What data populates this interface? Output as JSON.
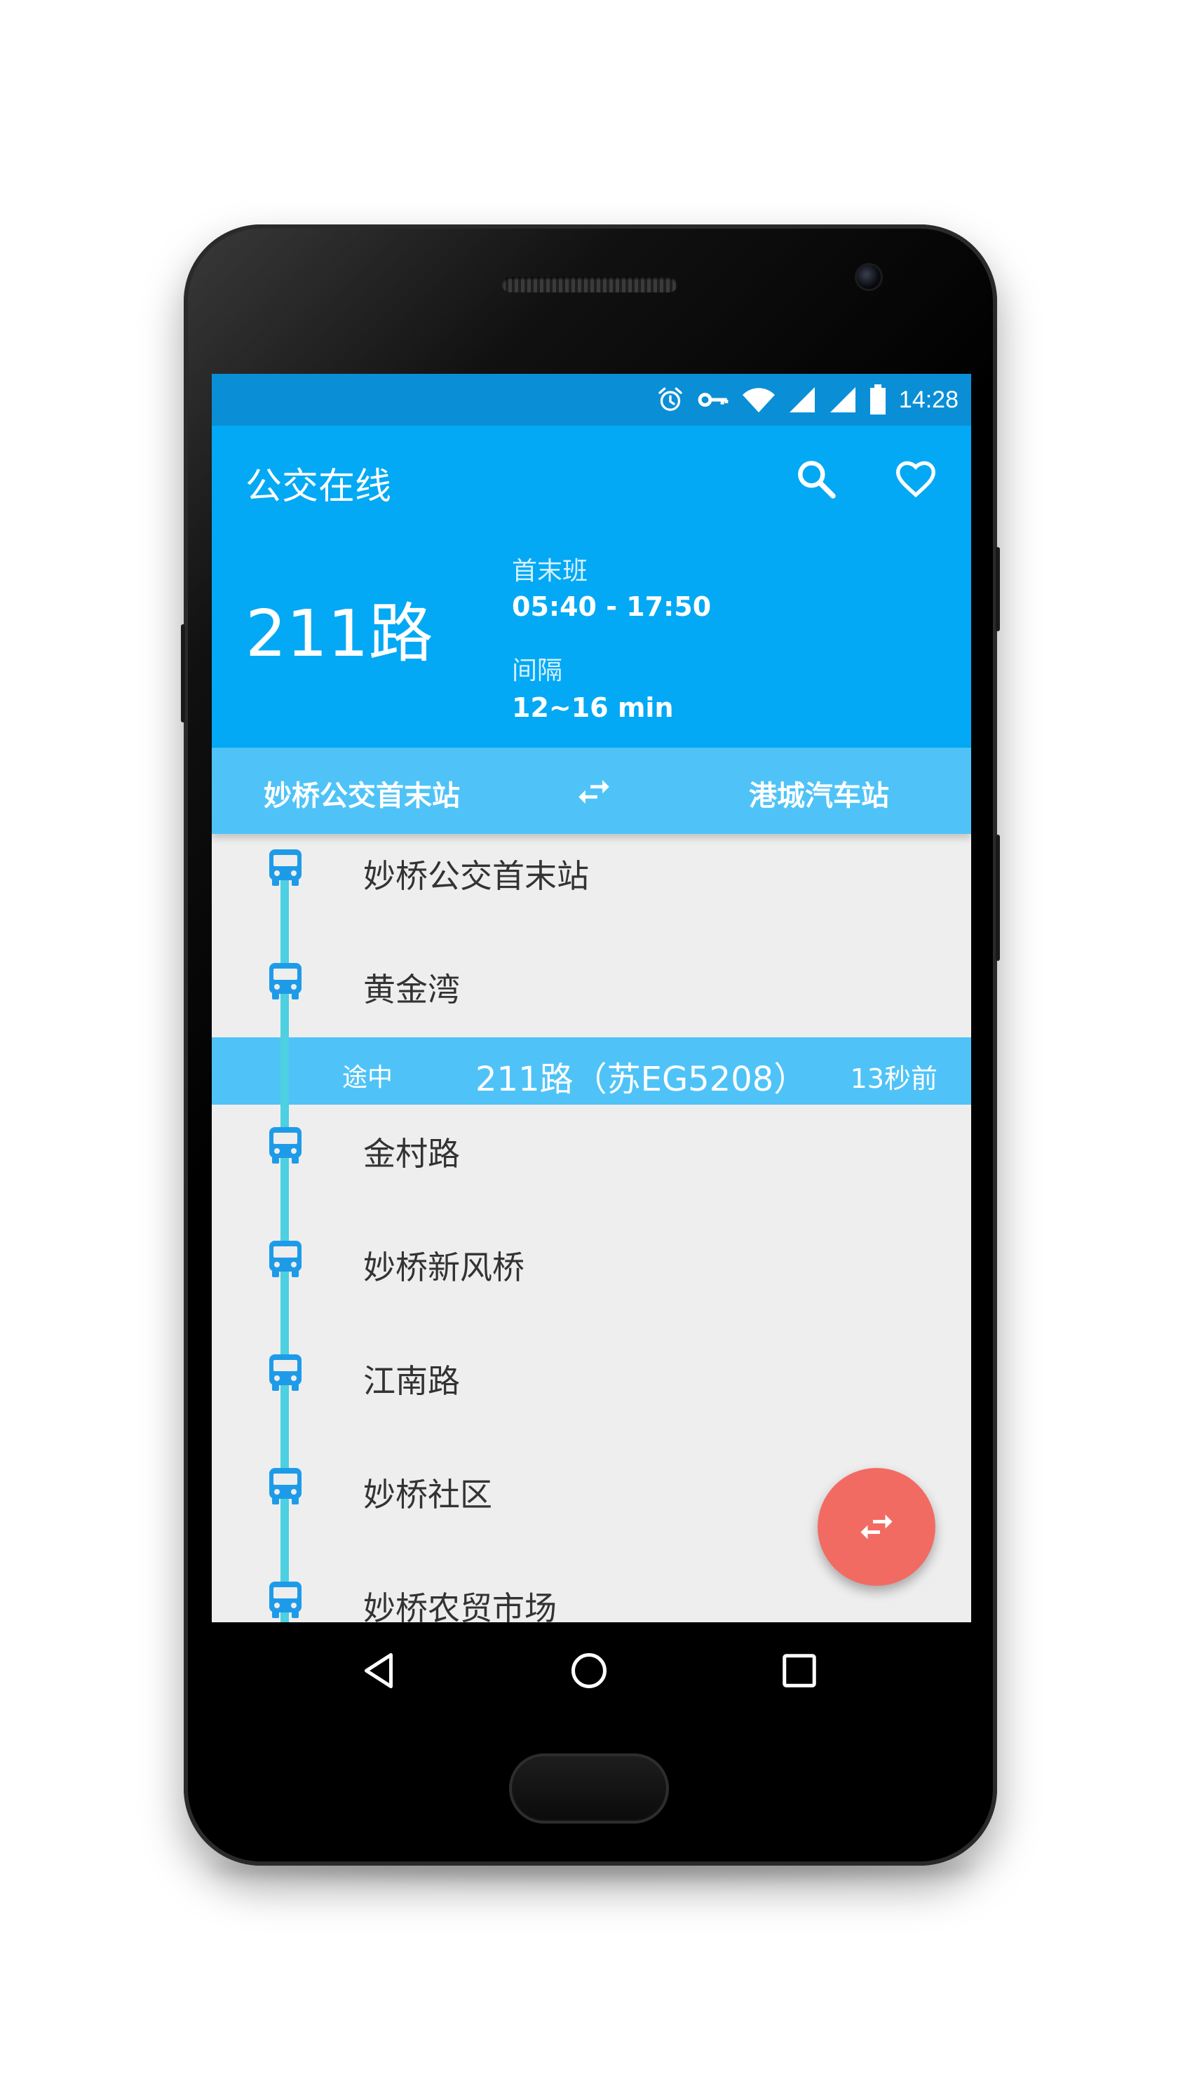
{
  "status_bar": {
    "time": "14:28",
    "icons": [
      "alarm-icon",
      "vpn-key-icon",
      "wifi-icon",
      "signal-icon",
      "signal-icon",
      "battery-icon"
    ]
  },
  "app_bar": {
    "title": "公交在线",
    "actions": [
      "search-icon",
      "heart-icon"
    ]
  },
  "route": {
    "name": "211路",
    "schedule_label": "首末班",
    "schedule_value": "05:40 - 17:50",
    "interval_label": "间隔",
    "interval_value": "12~16 min"
  },
  "direction": {
    "from": "妙桥公交首末站",
    "to": "港城汽车站",
    "swap_icon": "swap-horiz-icon"
  },
  "stations": [
    {
      "name": "妙桥公交首末站"
    },
    {
      "name": "黄金湾"
    },
    {
      "name": "金村路"
    },
    {
      "name": "妙桥新风桥"
    },
    {
      "name": "江南路"
    },
    {
      "name": "妙桥社区"
    },
    {
      "name": "妙桥农贸市场"
    }
  ],
  "in_transit": {
    "status": "途中",
    "bus": "211路（苏EG5208）",
    "time": "13秒前"
  },
  "fab": {
    "icon": "swap-horiz-icon"
  },
  "nav_bar": {
    "buttons": [
      "back-icon",
      "home-icon",
      "recents-icon"
    ]
  },
  "colors": {
    "primary": "#03a9f4",
    "primary_dark": "#0a8fd6",
    "light_blue": "#4fc3f7",
    "timeline": "#4dd0e1",
    "bus_icon": "#1e9be8",
    "accent": "#f26b63",
    "list_background": "#eeeeee"
  }
}
